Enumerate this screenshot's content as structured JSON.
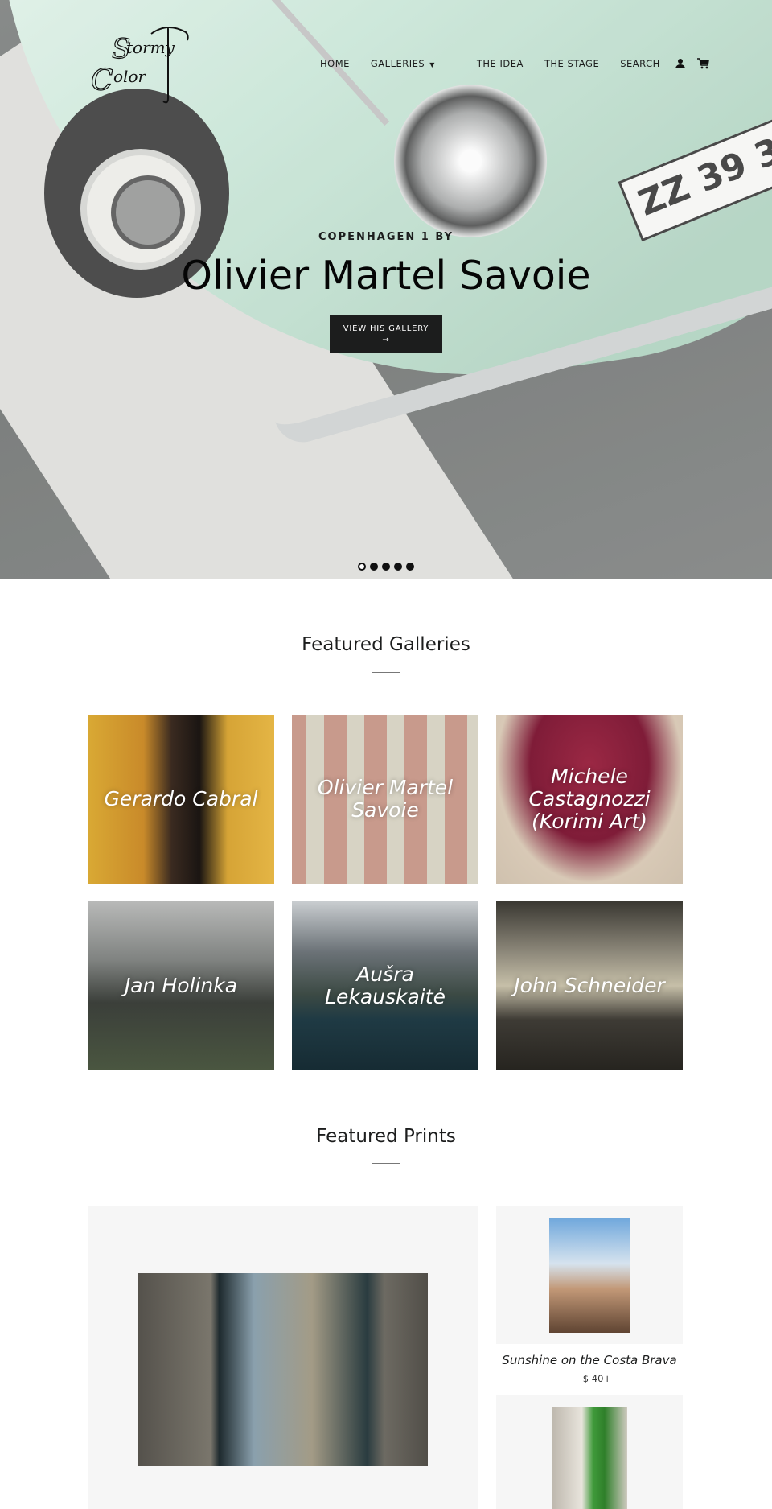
{
  "brand": {
    "logo_text": "Stormy Color"
  },
  "nav": {
    "items": [
      {
        "label": "HOME"
      },
      {
        "label": "GALLERIES",
        "has_dropdown": true
      },
      {
        "label": "THE IDEA"
      },
      {
        "label": "THE STAGE"
      },
      {
        "label": "SEARCH"
      }
    ],
    "account_icon": "user-icon",
    "cart_icon": "cart-icon"
  },
  "hero": {
    "subtitle": "COPENHAGEN 1 BY",
    "title": "Olivier Martel Savoie",
    "button_label": "VIEW HIS GALLERY",
    "button_arrow": "→",
    "slides": 5,
    "active_slide": 1,
    "plate_text": "ZZ 39 3"
  },
  "galleries": {
    "title": "Featured Galleries",
    "items": [
      {
        "name": "Gerardo Cabral"
      },
      {
        "name": "Olivier Martel Savoie"
      },
      {
        "name": "Michele Castagnozzi (Korimi Art)"
      },
      {
        "name": "Jan Holinka"
      },
      {
        "name": "Aušra Lekauskaitė"
      },
      {
        "name": "John Schneider"
      }
    ]
  },
  "prints": {
    "title": "Featured Prints",
    "items": [
      {
        "title": "Sunshine on the Costa Brava",
        "price_prefix": "—",
        "price": "$ 40+"
      }
    ]
  }
}
